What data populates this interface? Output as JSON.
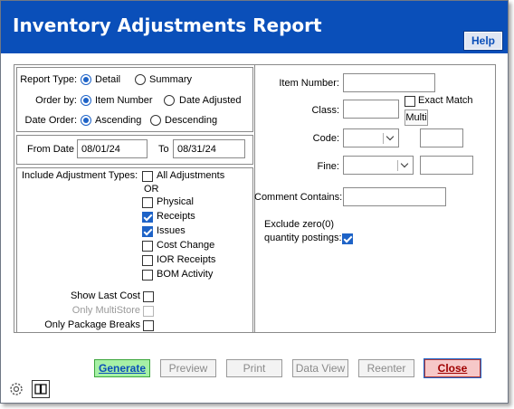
{
  "window": {
    "title": "Inventory Adjustments Report",
    "help_label": "Help"
  },
  "report_type": {
    "label": "Report Type:",
    "options": [
      "Detail",
      "Summary"
    ],
    "selected": "Detail"
  },
  "order_by": {
    "label": "Order by:",
    "options": [
      "Item Number",
      "Date Adjusted"
    ],
    "selected": "Item Number"
  },
  "date_order": {
    "label": "Date Order:",
    "options": [
      "Ascending",
      "Descending"
    ],
    "selected": "Ascending"
  },
  "dates": {
    "from_label": "From Date",
    "from_value": "08/01/24",
    "to_label": "To",
    "to_value": "08/31/24"
  },
  "adjustment_types": {
    "label": "Include Adjustment Types:",
    "all_label": "All Adjustments",
    "or_label": "OR",
    "items": [
      {
        "label": "Physical",
        "checked": false
      },
      {
        "label": "Receipts",
        "checked": true
      },
      {
        "label": "Issues",
        "checked": true
      },
      {
        "label": "Cost Change",
        "checked": false
      },
      {
        "label": "IOR Receipts",
        "checked": false
      },
      {
        "label": "BOM Activity",
        "checked": false
      }
    ]
  },
  "options": {
    "show_last_cost": "Show Last Cost",
    "only_multistore": "Only MultiStore",
    "only_package_breaks": "Only Package Breaks"
  },
  "filters": {
    "item_number_label": "Item Number:",
    "item_number_value": "",
    "class_label": "Class:",
    "class_value": "",
    "exact_match_label": "Exact Match",
    "multi_label": "Multi",
    "code_label": "Code:",
    "fine_label": "Fine:",
    "comment_label": "Comment Contains:",
    "comment_value": "",
    "exclude_zero_line1": "Exclude zero(0)",
    "exclude_zero_line2": "quantity postings:",
    "exclude_zero_checked": true
  },
  "buttons": {
    "generate": "Generate",
    "preview": "Preview",
    "print": "Print",
    "data_view": "Data View",
    "reenter": "Reenter",
    "close": "Close"
  },
  "icons": [
    "gear-icon",
    "book-icon"
  ]
}
